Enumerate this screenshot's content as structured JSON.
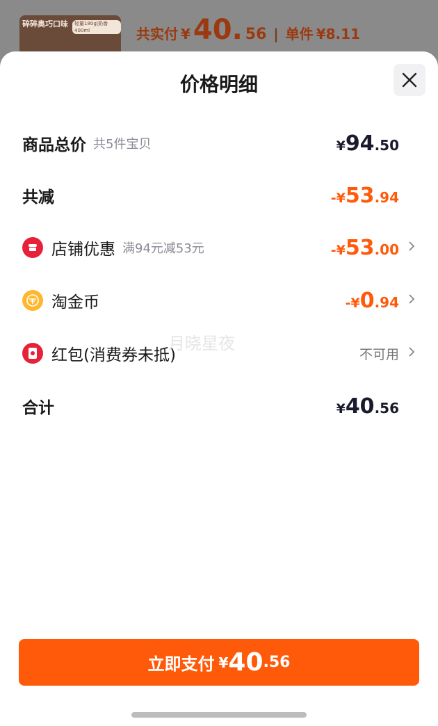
{
  "background": {
    "product_thumb_title": "碎碎奥巧口味",
    "product_thumb_tag": "轻量180g|奶香400ml",
    "total_label": "共实付",
    "currency": "¥",
    "total_int": "40.",
    "total_dec": "56",
    "separator": "|",
    "unit_label": "单件",
    "unit_price": "¥8.11"
  },
  "sheet": {
    "title": "价格明细",
    "close_icon": "close-icon"
  },
  "rows": {
    "goods_total": {
      "label": "商品总价",
      "sub": "共5件宝贝",
      "currency": "¥",
      "int": "94",
      "dec": ".50"
    },
    "total_reduction": {
      "label": "共减",
      "currency": "-¥",
      "int": "53",
      "dec": ".94"
    },
    "store_discount": {
      "icon": "store-icon",
      "label": "店铺优惠",
      "sub": "满94元减53元",
      "currency": "-¥",
      "int": "53",
      "dec": ".00"
    },
    "taojinbi": {
      "icon": "coin-icon",
      "label": "淘金币",
      "currency": "-¥",
      "int": "0",
      "dec": ".94"
    },
    "red_packet": {
      "icon": "red-packet-icon",
      "label": "红包(消费券未抵)",
      "status": "不可用"
    },
    "subtotal": {
      "label": "合计",
      "currency": "¥",
      "int": "40",
      "dec": ".56"
    }
  },
  "watermark": "月晓星夜",
  "pay_button": {
    "label": "立即支付",
    "currency": "¥",
    "int": "40",
    "dec": ".56"
  },
  "colors": {
    "accent": "#ff5a0a",
    "text_dark": "#1a1a2e",
    "text_muted": "#8a8a96",
    "store_icon_red": "#e8213a",
    "coin_yellow": "#ffb82e"
  }
}
